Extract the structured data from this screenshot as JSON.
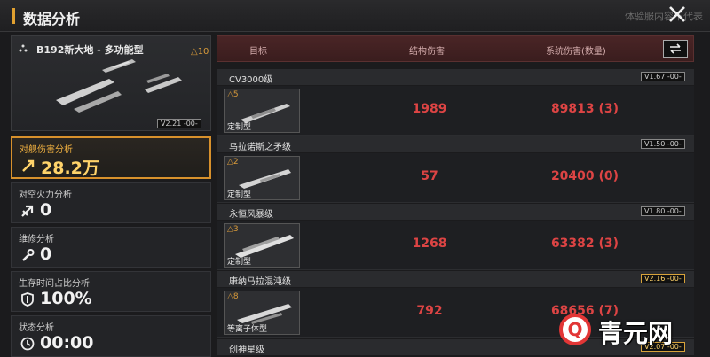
{
  "header": {
    "title": "数据分析",
    "watermark": "体验服内容不代表"
  },
  "ship": {
    "name": "B192新大地 - 多功能型",
    "level": "△10",
    "version": "V2.21 -00-"
  },
  "stats": [
    {
      "label": "对舰伤害分析",
      "value": "28.2万",
      "icon": "damage-icon"
    },
    {
      "label": "对空火力分析",
      "value": "0",
      "icon": "anti-air-icon"
    },
    {
      "label": "维修分析",
      "value": "0",
      "icon": "wrench-icon"
    },
    {
      "label": "生存时间占比分析",
      "value": "100%",
      "icon": "shield-icon"
    },
    {
      "label": "状态分析",
      "value": "00:00",
      "icon": "clock-icon"
    }
  ],
  "table": {
    "headers": [
      "目标",
      "结构伤害",
      "系统伤害(数量)"
    ],
    "groups": [
      {
        "class": "CV3000级",
        "version": "V1.67 -00-",
        "star": "△5",
        "kind": "定制型",
        "structure": "1989",
        "system": "89813 (3)"
      },
      {
        "class": "乌拉诺斯之矛级",
        "version": "V1.50 -00-",
        "star": "△2",
        "kind": "定制型",
        "structure": "57",
        "system": "20400 (0)"
      },
      {
        "class": "永恒风暴级",
        "version": "V1.80 -00-",
        "star": "△3",
        "kind": "定制型",
        "structure": "1268",
        "system": "63382 (3)"
      },
      {
        "class": "康纳马拉混沌级",
        "version": "V2.16 -00-",
        "star": "△8",
        "kind": "等离子体型",
        "structure": "792",
        "system": "68656 (7)"
      },
      {
        "class": "创神星级",
        "version": "V2.07 -00-"
      }
    ]
  },
  "brand": {
    "logo_letter": "Q",
    "name": "青元网"
  },
  "colors": {
    "accent": "#d8912c",
    "damage": "#dd4444",
    "header_red": "#4a2526"
  }
}
